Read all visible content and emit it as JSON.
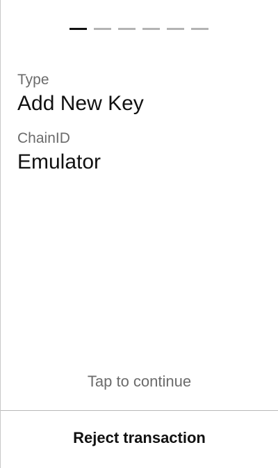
{
  "progress": {
    "total_steps": 6,
    "current_step": 1,
    "active_color": "#111111",
    "inactive_color": "#b3b3b3"
  },
  "fields": {
    "type_label": "Type",
    "type_value": "Add New Key",
    "chain_label": "ChainID",
    "chain_value": "Emulator"
  },
  "hint": {
    "tap_to_continue": "Tap to continue"
  },
  "footer": {
    "reject_label": "Reject transaction"
  }
}
